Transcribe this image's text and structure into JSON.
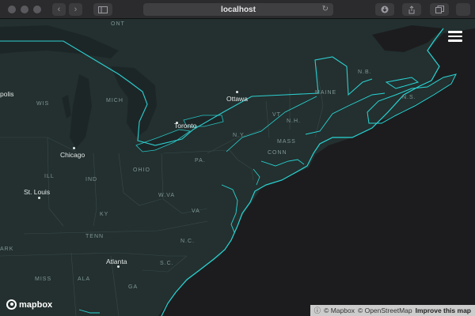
{
  "browser": {
    "url": "localhost",
    "nav_back": "‹",
    "nav_forward": "›",
    "reload_icon": "↻"
  },
  "map": {
    "theme": "dark",
    "colors": {
      "land": "#23302f",
      "water": "#1c1c1e",
      "lakes": "#1d2627",
      "coast": "#28d6d6",
      "borders": "#3a4a49"
    },
    "region_labels": {
      "ont": "ONT",
      "wis": "WIS",
      "mich": "MICH",
      "ill": "ILL",
      "ind": "IND",
      "ohio": "OHIO",
      "ky": "KY",
      "tenn": "TENN",
      "ark": "ARK",
      "miss": "MISS",
      "ala": "ALA",
      "ga": "GA",
      "sc": "S.C.",
      "nc": "N.C.",
      "va": "VA",
      "wva": "W.VA",
      "pa": "PA.",
      "ny": "N.Y.",
      "vt": "VT",
      "nh": "N.H.",
      "maine": "MAINE",
      "mass": "MASS",
      "conn": "CONN",
      "nb": "N.B.",
      "ns": "N.S."
    },
    "cities": {
      "chicago": "Chicago",
      "st_louis": "St. Louis",
      "toronto": "Toronto",
      "ottawa": "Ottawa",
      "atlanta": "Atlanta",
      "minneapolis_fragment": "polis"
    }
  },
  "controls": {
    "menu_icon": "hamburger-icon"
  },
  "branding": {
    "logo_text": "mapbox"
  },
  "attribution": {
    "mapbox": "© Mapbox",
    "osm": "© OpenStreetMap",
    "improve": "Improve this map"
  }
}
